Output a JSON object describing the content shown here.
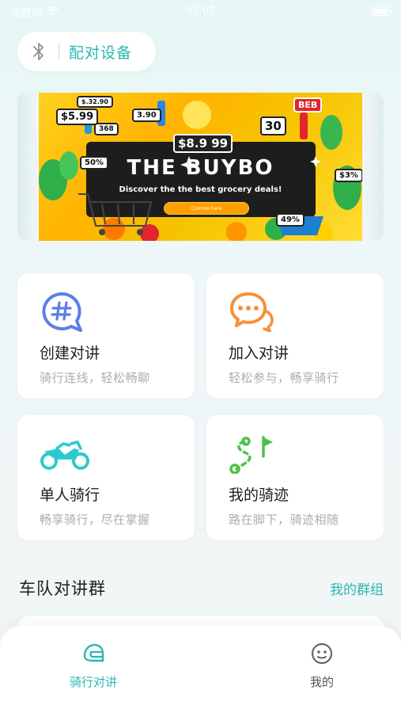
{
  "status_bar": {
    "carrier": "运营商",
    "time": "03:02"
  },
  "pair_device": {
    "label": "配对设备",
    "icon": "bluetooth-icon"
  },
  "banner": {
    "title": "THE BUYBO",
    "subtitle": "Discover the the best grocery deals!",
    "button_label": "Comme here",
    "prices": [
      "$5.99",
      "$8.9 99",
      "30",
      "50%",
      "$3%",
      "49%",
      "BEB",
      "368",
      "3.90",
      "$.32.90"
    ]
  },
  "features": [
    {
      "title": "创建对讲",
      "desc": "骑行连线，轻松畅聊",
      "icon": "hash-chat-icon",
      "color": "#5b7fe8"
    },
    {
      "title": "加入对讲",
      "desc": "轻松参与，畅享骑行",
      "icon": "chat-bubbles-icon",
      "color": "#f5913a"
    },
    {
      "title": "单人骑行",
      "desc": "畅享骑行，尽在掌握",
      "icon": "motorcycle-icon",
      "color": "#2ccad0"
    },
    {
      "title": "我的骑迹",
      "desc": "路在脚下，骑迹相随",
      "icon": "route-flag-icon",
      "color": "#4ec24a"
    }
  ],
  "section": {
    "title": "车队对讲群",
    "link": "我的群组"
  },
  "bottom_nav": [
    {
      "label": "骑行对讲",
      "icon": "helmet-icon",
      "active": true
    },
    {
      "label": "我的",
      "icon": "smiley-icon",
      "active": false
    }
  ],
  "colors": {
    "accent": "#2bb7b2",
    "muted_text": "#a9aeb1"
  }
}
